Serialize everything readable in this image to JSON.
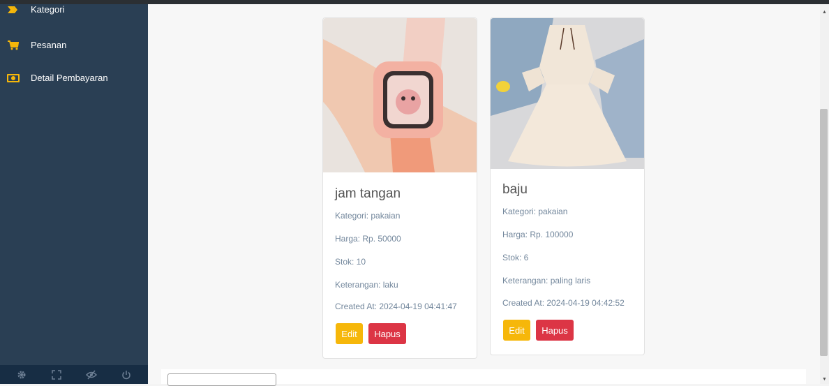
{
  "sidebar": {
    "items": [
      {
        "label": "Kategori",
        "icon": "tag-icon"
      },
      {
        "label": "Pesanan",
        "icon": "cart-icon"
      },
      {
        "label": "Detail Pembayaran",
        "icon": "money-icon"
      }
    ],
    "footer_icons": [
      "gear-icon",
      "fullscreen-icon",
      "eye-slash-icon",
      "power-icon"
    ]
  },
  "products": [
    {
      "name": "jam tangan",
      "kategori": "Kategori: pakaian",
      "harga": "Harga: Rp. 50000",
      "stok": "Stok: 10",
      "keterangan": "Keterangan: laku",
      "created": "Created At: 2024-04-19 04:41:47"
    },
    {
      "name": "baju",
      "kategori": "Kategori: pakaian",
      "harga": "Harga: Rp. 100000",
      "stok": "Stok: 6",
      "keterangan": "Keterangan: paling laris",
      "created": "Created At: 2024-04-19 04:42:52"
    }
  ],
  "buttons": {
    "edit": "Edit",
    "delete": "Hapus"
  },
  "colors": {
    "sidebar": "#2a3f54",
    "edit": "#f6b70a",
    "delete": "#dc3545"
  }
}
